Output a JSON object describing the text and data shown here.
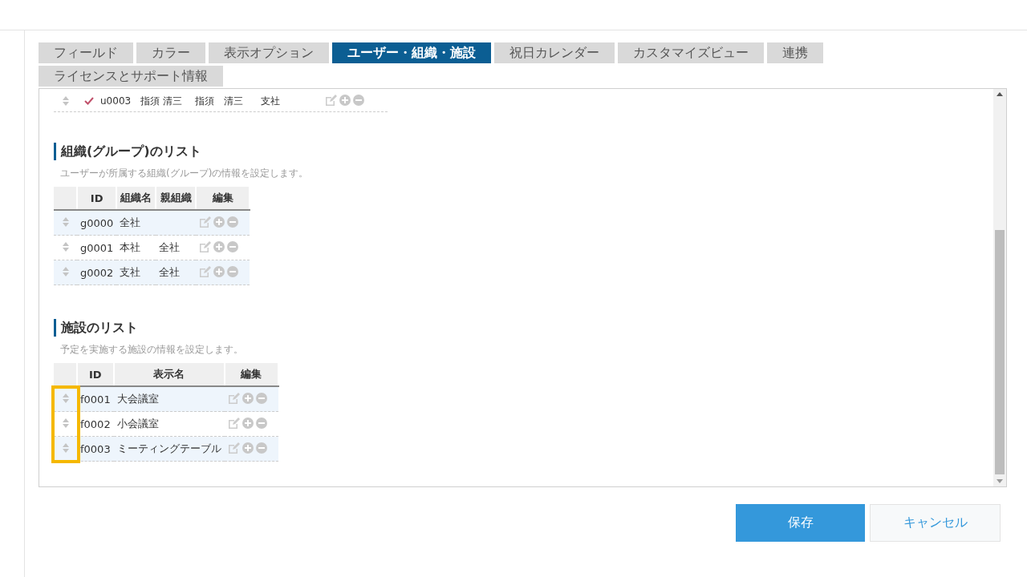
{
  "tabs": [
    {
      "label": "フィールド",
      "selected": false
    },
    {
      "label": "カラー",
      "selected": false
    },
    {
      "label": "表示オプション",
      "selected": false
    },
    {
      "label": "ユーザー・組織・施設",
      "selected": true
    },
    {
      "label": "祝日カレンダー",
      "selected": false
    },
    {
      "label": "カスタマイズビュー",
      "selected": false
    },
    {
      "label": "連携",
      "selected": false
    },
    {
      "label": "ライセンスとサポート情報",
      "selected": false
    }
  ],
  "user_row": {
    "checked": true,
    "cells": [
      "u0003",
      "指須 清三",
      "指須　清三",
      "支社"
    ]
  },
  "sections": [
    {
      "title": "組織(グループ)のリスト",
      "description": "ユーザーが所属する組織(グループ)の情報を設定します。",
      "drag_handles_highlighted": false,
      "columns": [
        "ID",
        "組織名",
        "親組織",
        "編集"
      ],
      "rows": [
        {
          "cells": [
            "g0000",
            "全社"
          ]
        },
        {
          "cells": [
            "g0001",
            "本社",
            "全社"
          ]
        },
        {
          "cells": [
            "g0002",
            "支社",
            "全社"
          ]
        }
      ]
    },
    {
      "title": "施設のリスト",
      "description": "予定を実施する施設の情報を設定します。",
      "drag_handles_highlighted": true,
      "columns": [
        "ID",
        "表示名",
        "編集"
      ],
      "rows": [
        {
          "cells": [
            "f0001",
            "大会議室"
          ]
        },
        {
          "cells": [
            "f0002",
            "小会議室"
          ]
        },
        {
          "cells": [
            "f0003",
            "ミーティングテーブル"
          ]
        }
      ]
    }
  ],
  "buttons": [
    {
      "label": "保存",
      "kind": "primary"
    },
    {
      "label": "キャンセル",
      "kind": "secondary"
    }
  ]
}
